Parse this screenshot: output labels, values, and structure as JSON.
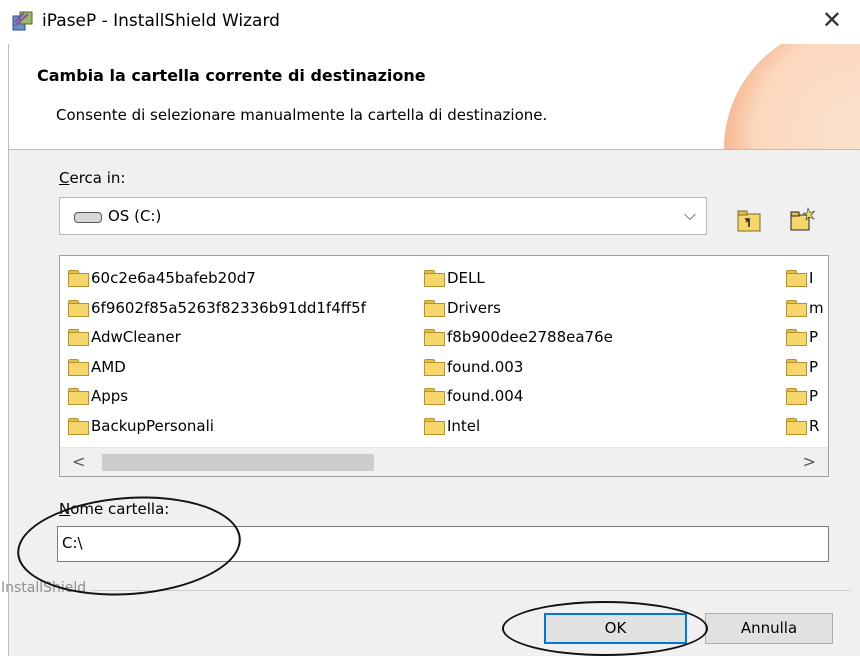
{
  "window": {
    "title": "iPaseP - InstallShield Wizard",
    "close_glyph": "✕",
    "app_icon": "installer-icon"
  },
  "header": {
    "title": "Cambia la cartella corrente di destinazione",
    "subtitle": "Consente di selezionare manualmente la cartella di destinazione."
  },
  "look_in": {
    "label_first": "C",
    "label_rest": "erca in:",
    "value": "OS (C:)",
    "arrow": "⌵"
  },
  "toolbar": {
    "up_icon": "folder-up-icon",
    "new_icon": "new-folder-icon"
  },
  "folders": {
    "col1": [
      "60c2e6a45bafeb20d7",
      "6f9602f85a5263f82336b91dd1f4ff5f",
      "AdwCleaner",
      "AMD",
      "Apps",
      "BackupPersonali"
    ],
    "col2": [
      "DELL",
      "Drivers",
      "f8b900dee2788ea76e",
      "found.003",
      "found.004",
      "Intel"
    ],
    "col3": [
      "I",
      "m",
      "P",
      "P",
      "P",
      "R"
    ]
  },
  "scroll": {
    "left": "<",
    "right": ">"
  },
  "folder_name": {
    "label_first": "N",
    "label_rest": "ome cartella:",
    "value": "C:\\"
  },
  "footer": {
    "brand": "InstallShield"
  },
  "buttons": {
    "ok": "OK",
    "cancel": "Annulla"
  },
  "colors": {
    "accent": "#0078d7",
    "folder": "#f6d66b",
    "header_orb": "#fbd7bd"
  }
}
